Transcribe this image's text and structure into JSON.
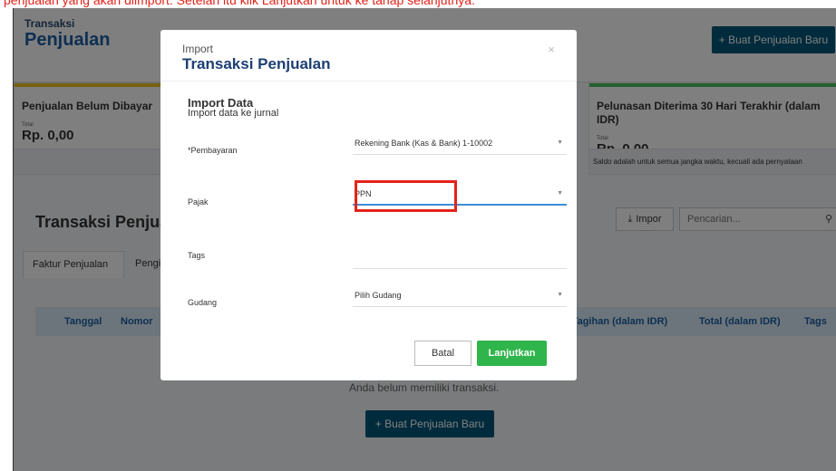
{
  "caption": "penjualan yang akan diimport. Setelah itu klik Lanjutkan untuk ke tahap selanjutnya.",
  "header": {
    "crumb": "Transaksi",
    "title": "Penjualan",
    "new_sale_label": "+ Buat Penjualan Baru"
  },
  "cards": [
    {
      "title": "Penjualan Belum Dibayar",
      "total_label": "Total",
      "amount": "Rp. 0,00",
      "color": "#f0c420"
    },
    {
      "title": "Pelunasan Diterima 30 Hari Terakhir (dalam IDR)",
      "total_label": "Total",
      "amount": "Rp. 0,00",
      "color": "#4cc262",
      "footer": "Saldo adalah untuk semua jangka waktu, kecuali ada pernyataan"
    }
  ],
  "section": {
    "title": "Transaksi Penjualan"
  },
  "tabs": [
    "Faktur Penjualan",
    "Pengiriman"
  ],
  "toolbar": {
    "impor_label": "Impor",
    "search_placeholder": "Pencarian..."
  },
  "table": {
    "columns": [
      "Tanggal",
      "Nomor",
      "Sisa Tagihan (dalam IDR)",
      "Total (dalam IDR)",
      "Tags"
    ]
  },
  "empty": {
    "message": "Anda belum memiliki transaksi.",
    "button_label": "+ Buat Penjualan Baru"
  },
  "modal": {
    "kicker": "Import",
    "title": "Transaksi Penjualan",
    "close": "×",
    "section_title": "Import Data",
    "section_subtitle": "Import data ke jurnal",
    "fields": {
      "pembayaran": {
        "label": "*Pembayaran",
        "value": "Rekening Bank (Kas & Bank) 1-10002"
      },
      "pajak": {
        "label": "Pajak",
        "value": "PPN"
      },
      "tags": {
        "label": "Tags",
        "value": ""
      },
      "gudang": {
        "label": "Gudang",
        "value": "Pilih Gudang"
      }
    },
    "cancel_label": "Batal",
    "continue_label": "Lanjutkan"
  },
  "colors": {
    "primary": "#00577b",
    "green": "#2fb54c",
    "highlight": "#e2231a",
    "focus": "#3d8dd9"
  }
}
